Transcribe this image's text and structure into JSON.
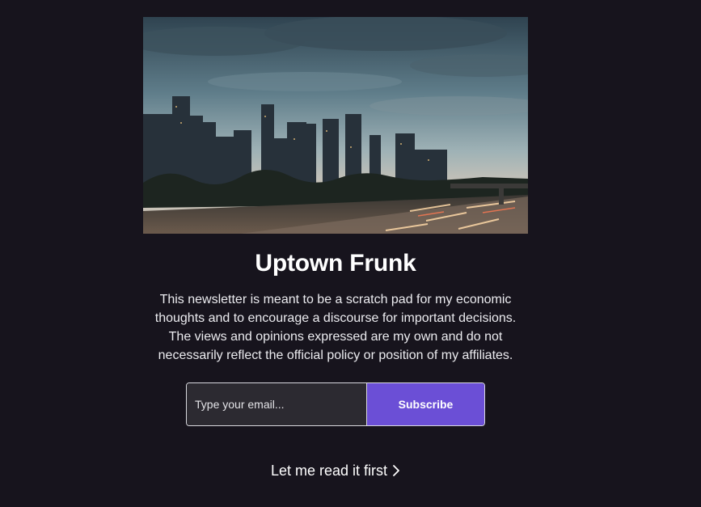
{
  "publication": {
    "title": "Uptown Frunk",
    "description": "This newsletter is meant to be a scratch pad for my economic thoughts and to encourage a discourse for important decisions. The views and opinions expressed are my own and do not necessarily reflect the official policy or position of my affiliates."
  },
  "subscribe_form": {
    "email_placeholder": "Type your email...",
    "email_value": "",
    "button_label": "Subscribe"
  },
  "read_first": {
    "label": "Let me read it first",
    "icon": "chevron-right-icon"
  },
  "colors": {
    "background": "#17141d",
    "accent": "#6b4fd6",
    "input_background": "#2c2a31"
  }
}
